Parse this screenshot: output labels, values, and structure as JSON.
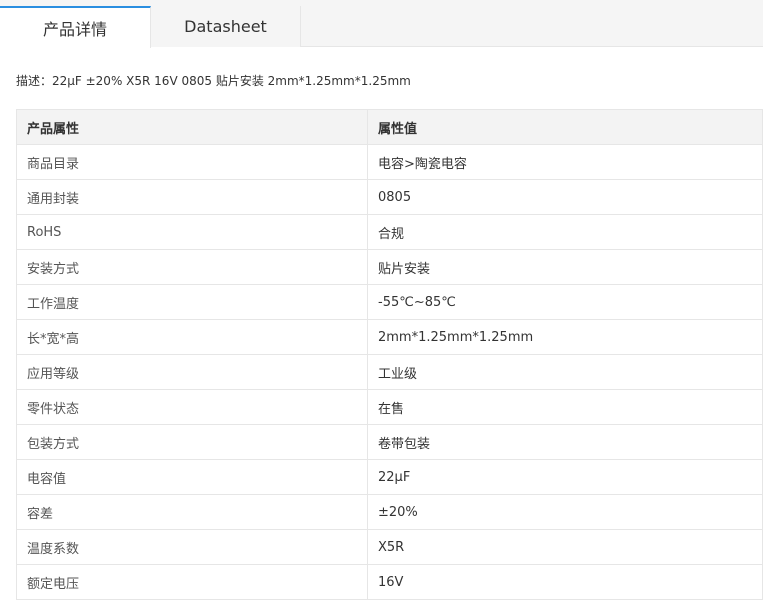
{
  "tabs": [
    {
      "label": "产品详情",
      "active": true
    },
    {
      "label": "Datasheet",
      "active": false
    }
  ],
  "description": "描述：22μF ±20% X5R 16V 0805 贴片安装 2mm*1.25mm*1.25mm",
  "table": {
    "headers": [
      "产品属性",
      "属性值"
    ],
    "rows": [
      {
        "name": "商品目录",
        "value": "电容>陶瓷电容"
      },
      {
        "name": "通用封装",
        "value": "0805"
      },
      {
        "name": "RoHS",
        "value": "合规"
      },
      {
        "name": "安装方式",
        "value": "贴片安装"
      },
      {
        "name": "工作温度",
        "value": "-55℃~85℃"
      },
      {
        "name": "长*宽*高",
        "value": "2mm*1.25mm*1.25mm"
      },
      {
        "name": "应用等级",
        "value": "工业级"
      },
      {
        "name": "零件状态",
        "value": "在售"
      },
      {
        "name": "包装方式",
        "value": "卷带包装"
      },
      {
        "name": "电容值",
        "value": "22μF"
      },
      {
        "name": "容差",
        "value": "±20%"
      },
      {
        "name": "温度系数",
        "value": "X5R"
      },
      {
        "name": "额定电压",
        "value": "16V"
      }
    ]
  },
  "colors": {
    "accent": "#2a8ee0",
    "header_bg": "#f3f3f3",
    "border": "#e6e6e6"
  }
}
